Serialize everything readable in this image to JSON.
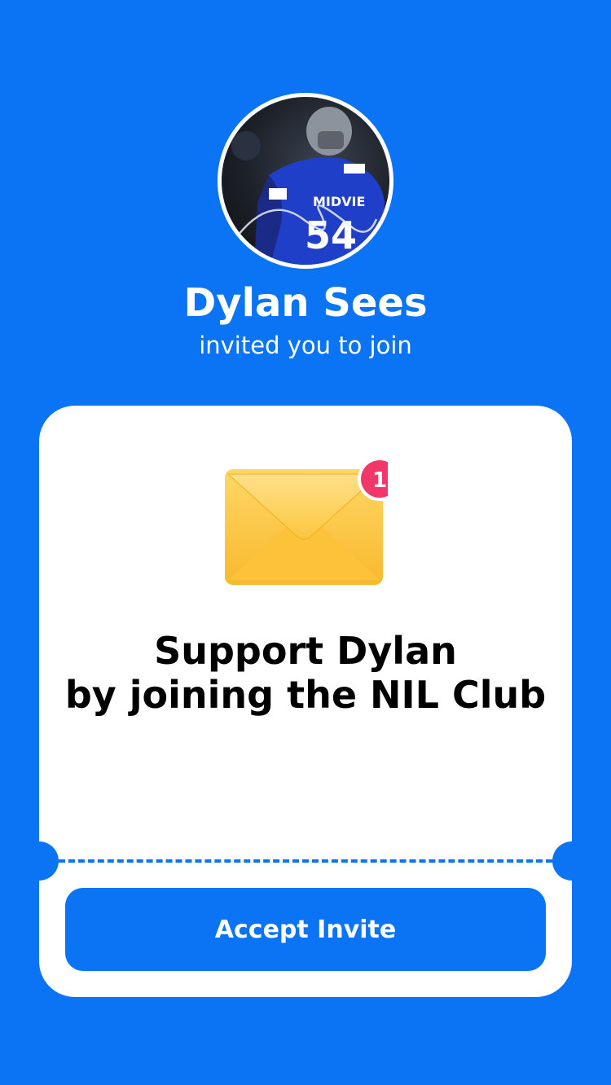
{
  "inviter": {
    "name": "Dylan Sees",
    "subtitle": "invited you to join",
    "avatar_icon": "athlete-photo"
  },
  "card": {
    "notification_count": "1",
    "headline_line1": "Support Dylan",
    "headline_line2": "by joining the NIL Club",
    "button_label": "Accept Invite",
    "icon": "envelope-icon"
  },
  "colors": {
    "background": "#0a74f5",
    "card": "#ffffff",
    "badge": "#f2386b",
    "envelope": "#fbc840"
  }
}
